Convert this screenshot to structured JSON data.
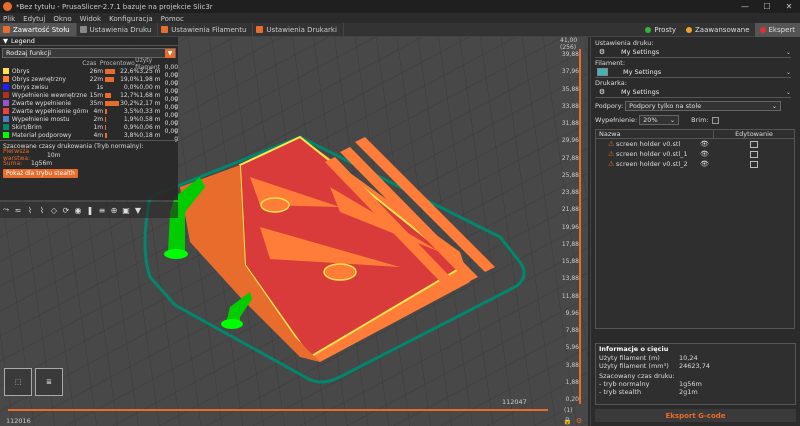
{
  "window": {
    "title": "*Bez tytułu - PrusaSlicer-2.7.1 bazuje na projekcie Slic3r"
  },
  "menu": [
    "Plik",
    "Edytuj",
    "Okno",
    "Widok",
    "Konfiguracja",
    "Pomoc"
  ],
  "tabs": [
    "Zawartość Stołu",
    "Ustawienia Druku",
    "Ustawienia Filamentu",
    "Ustawienia Drukarki"
  ],
  "modes": [
    {
      "label": "Prosty",
      "color": "#36b336"
    },
    {
      "label": "Zaawansowane",
      "color": "#e8a52b"
    },
    {
      "label": "Ekspert",
      "color": "#e03030"
    }
  ],
  "legend": {
    "title": "Legend",
    "view_type": "Rodzaj funkcji",
    "columns": {
      "time": "Czas",
      "percent": "Procentowo",
      "filament": "Użyty filament"
    },
    "rows": [
      {
        "name": "Obrys",
        "time": "26m",
        "percent": "22,6%",
        "pct_value": 22.6,
        "meters": "3,25 m",
        "grams": "0,00 g",
        "color": "#ffe54d"
      },
      {
        "name": "Obrys zewnętrzny",
        "time": "22m",
        "percent": "19,0%",
        "pct_value": 19.0,
        "meters": "1,98 m",
        "grams": "0,00 g",
        "color": "#ff7d38"
      },
      {
        "name": "Obrys zwisu",
        "time": "1s",
        "percent": "0,0%",
        "pct_value": 0.0,
        "meters": "0,00 m",
        "grams": "0,00 g",
        "color": "#1f1fff"
      },
      {
        "name": "Wypełnienie wewnętrzne",
        "time": "15m",
        "percent": "12,7%",
        "pct_value": 12.7,
        "meters": "1,68 m",
        "grams": "0,00 g",
        "color": "#b03029"
      },
      {
        "name": "Zwarte wypełnienie",
        "time": "35m",
        "percent": "30,2%",
        "pct_value": 30.2,
        "meters": "2,17 m",
        "grams": "0,00 g",
        "color": "#9654cc"
      },
      {
        "name": "Zwarte wypełnienie górne",
        "time": "4m",
        "percent": "3,5%",
        "pct_value": 3.5,
        "meters": "0,33 m",
        "grams": "0,00 g",
        "color": "#f04040"
      },
      {
        "name": "Wypełnienie mostu",
        "time": "2m",
        "percent": "1,9%",
        "pct_value": 1.9,
        "meters": "0,58 m",
        "grams": "0,00 g",
        "color": "#4d80ba"
      },
      {
        "name": "Skirt/Brim",
        "time": "1m",
        "percent": "0,9%",
        "pct_value": 0.9,
        "meters": "0,06 m",
        "grams": "0,00 g",
        "color": "#00876e"
      },
      {
        "name": "Materiał podporowy",
        "time": "4m",
        "percent": "3,8%",
        "pct_value": 3.8,
        "meters": "0,18 m",
        "grams": "0,00 g",
        "color": "#00ff00"
      }
    ],
    "estimate_header": "Szacowane czasy drukowania (Tryb normalny):",
    "first_layer_label": "Pierwsza warstwa:",
    "first_layer_value": "10m",
    "total_label": "Suma:",
    "total_value": "1g56m",
    "stealth_button": "Pokaż dla trybu stealth"
  },
  "vertical_slider": {
    "top_value": "41,00",
    "top_layer": "(256)",
    "ticks": [
      "39,88",
      "37,96",
      "35,88",
      "33,88",
      "31,88",
      "29,96",
      "27,88",
      "25,88",
      "23,88",
      "21,88",
      "19,96",
      "17,88",
      "15,88",
      "13,88",
      "11,88",
      "9,96",
      "7,88",
      "5,96",
      "3,88",
      "1,88",
      "0,20"
    ],
    "bottom_layer": "(1)"
  },
  "horizontal_slider": {
    "right_value": "112047",
    "left_value": "112016"
  },
  "right_panel": {
    "print_settings_label": "Ustawienia druku:",
    "print_settings_value": "My Settings",
    "filament_label": "Filament:",
    "filament_value": "My Settings",
    "filament_color": "#3fb5b5",
    "printer_label": "Drukarka:",
    "printer_value": "My Settings",
    "supports_label": "Podpory:",
    "supports_value": "Podpory tylko na stole",
    "infill_label": "Wypełnienie:",
    "infill_value": "20%",
    "brim_label": "Brim:",
    "table_headers": {
      "name": "Nazwa",
      "editing": "Edytowanie"
    },
    "objects": [
      "screen holder v0.stl",
      "screen holder v0.stl_1",
      "screen holder v0.stl_2"
    ],
    "slice_info": {
      "title": "Informacje o cięciu",
      "rows": [
        {
          "k": "Użyty filament (m)",
          "v": "10,24"
        },
        {
          "k": "Użyty filament (mm³)",
          "v": "24623,74"
        },
        {
          "k": "Szacowany czas druku:",
          "v": ""
        },
        {
          "k": " - tryb normalny",
          "v": "1g56m"
        },
        {
          "k": " - tryb stealth",
          "v": "2g1m"
        }
      ]
    },
    "export_button": "Eksport G-code"
  }
}
